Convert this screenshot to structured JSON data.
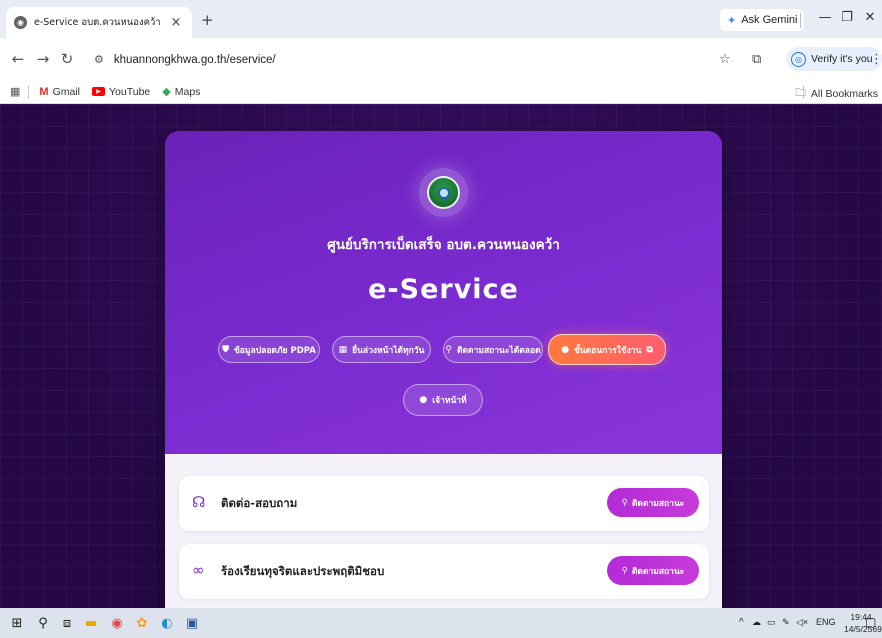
{
  "browser": {
    "tab_title": "e-Service อบต.ควนหนองคว้า",
    "new_tab": "+",
    "tab_close": "×",
    "gemini_label": "Ask Gemini",
    "url": "khuannongkhwa.go.th/eservice/",
    "verify_label": "Verify it's you",
    "bookmarks": [
      {
        "label": "Gmail",
        "icon": "gmail-icon"
      },
      {
        "label": "YouTube",
        "icon": "youtube-icon"
      },
      {
        "label": "Maps",
        "icon": "maps-icon"
      }
    ],
    "all_bookmarks": "All Bookmarks"
  },
  "page": {
    "org_name": "ศูนย์บริการเบ็ดเสร็จ อบต.ควนหนองคว้า",
    "title": "e-Service",
    "pills": [
      {
        "label": "ข้อมูลปลอดภัย PDPA",
        "icon": "shield-icon"
      },
      {
        "label": "ยื่นล่วงหน้าได้ทุกวัน",
        "icon": "calendar-icon"
      },
      {
        "label": "ติดตามสถานะได้ตลอด",
        "icon": "search-icon"
      },
      {
        "label": "ขั้นตอนการใช้งาน",
        "icon": "play-icon",
        "trailing_icon": "external-link-icon"
      }
    ],
    "officer_label": "เจ้าหน้าที่",
    "services": [
      {
        "label": "ติดต่อ-สอบถาม",
        "icon": "headset-icon",
        "button": "ติดตามสถานะ"
      },
      {
        "label": "ร้องเรียนทุจริตและประพฤติมิชอบ",
        "icon": "binoculars-icon",
        "button": "ติดตามสถานะ"
      }
    ],
    "colors": {
      "background": "#2a0a4c",
      "hero": "#7a2bd0",
      "accent_pill": "#ff6a55",
      "service_button": "#c63bd8"
    }
  },
  "taskbar": {
    "language": "ENG",
    "time": "19:44",
    "date": "14/5/2569"
  }
}
